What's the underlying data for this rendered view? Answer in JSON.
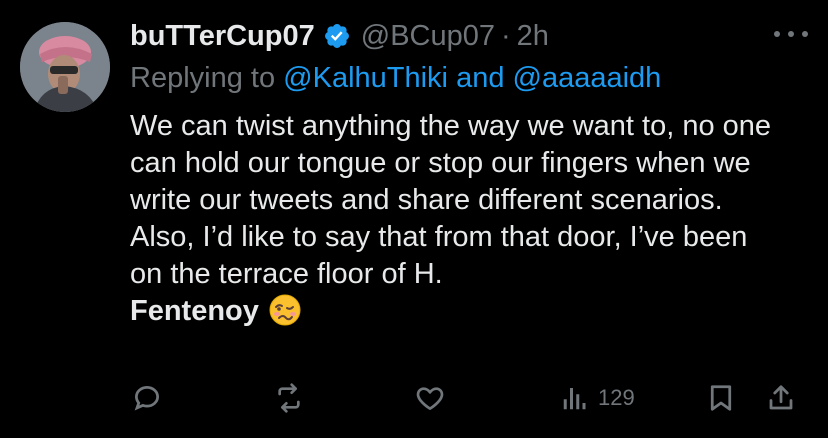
{
  "tweet": {
    "author": {
      "display_name": "buTTerCup07",
      "handle": "@BCup07",
      "verified": true,
      "avatar_icon": "profile-photo"
    },
    "separator": "·",
    "time": "2h",
    "reply": {
      "prefix": "Replying to",
      "mention_1": "@KalhuThiki",
      "joiner": "and",
      "mention_2": "@aaaaaidh"
    },
    "text_main": "We can twist anything the way we want to, no one can hold our tongue or stop our fingers when we write our tweets and share different scenarios. Also, I’d like to say that from that door, I’ve been on the terrace floor of H.",
    "text_bold": "Fentenoy",
    "emoji": "woozy-face",
    "views_count": "129"
  },
  "icons": {
    "more": "more-icon",
    "reply": "reply-icon",
    "retweet": "retweet-icon",
    "like": "heart-icon",
    "views": "views-icon",
    "bookmark": "bookmark-icon",
    "share": "share-icon"
  },
  "colors": {
    "background": "#000000",
    "text": "#e7e9ea",
    "muted": "#71767b",
    "link": "#1d9bf0",
    "verified": "#1d9bf0"
  }
}
